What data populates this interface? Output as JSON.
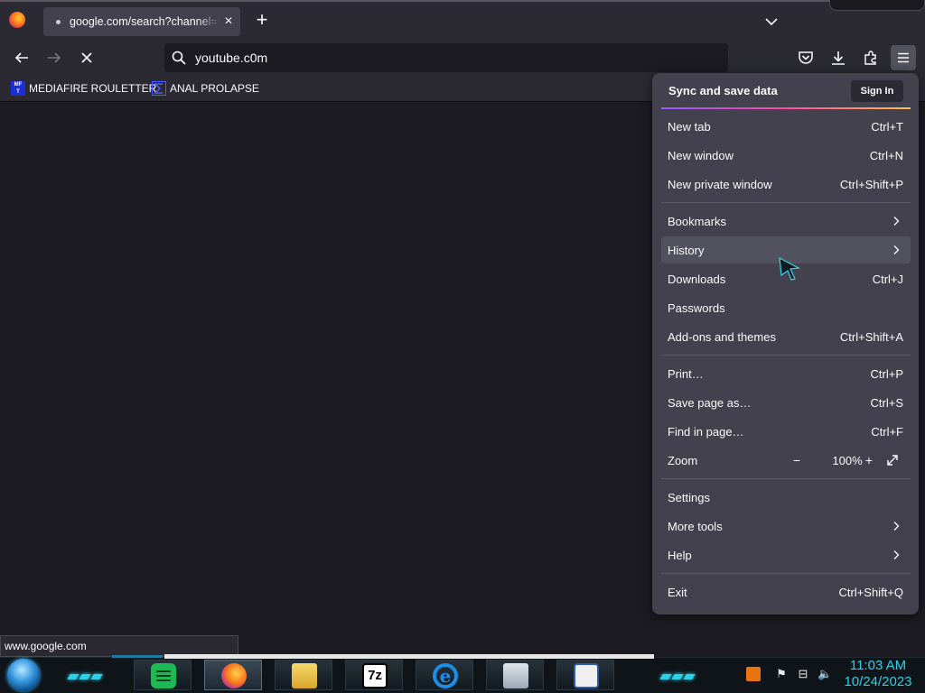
{
  "colors": {
    "chrome_bg": "#2b2a33",
    "page_bg": "#1c1b22",
    "menu_bg": "#42414d",
    "accent_gradient": [
      "#9059ff",
      "#ff4aa2",
      "#ffbd4f"
    ],
    "taskbar_accent": "#2ad1e8"
  },
  "tabstrip": {
    "active_tab": {
      "title": "google.com/search?channel=fs",
      "favicon": "loading-dot-icon",
      "close_icon": "close-icon"
    },
    "new_tab_icon": "plus-icon",
    "list_all_tabs_icon": "chevron-down-icon"
  },
  "navbar": {
    "back_icon": "back-arrow-icon",
    "forward_icon": "forward-arrow-icon",
    "stop_icon": "stop-icon",
    "url": "youtube.c0m",
    "toolbar_icons": [
      "pocket-icon",
      "download-icon",
      "extensions-icon",
      "hamburger-menu-icon"
    ]
  },
  "bookmarks": [
    {
      "label": "MEDIAFIRE ROULETTER",
      "icon": "mft-icon",
      "icon_text": "MF T"
    },
    {
      "label": "ANAL PROLAPSE",
      "icon": "sigma-icon"
    }
  ],
  "status_url": "www.google.com",
  "app_menu": {
    "header": {
      "title": "Sync and save data",
      "sign_in": "Sign In"
    },
    "items": [
      {
        "label": "New tab",
        "shortcut": "Ctrl+T"
      },
      {
        "label": "New window",
        "shortcut": "Ctrl+N"
      },
      {
        "label": "New private window",
        "shortcut": "Ctrl+Shift+P"
      },
      {
        "label": "Bookmarks",
        "shortcut": "",
        "submenu": true
      },
      {
        "label": "History",
        "shortcut": "",
        "submenu": true,
        "hovered": true
      },
      {
        "label": "Downloads",
        "shortcut": "Ctrl+J"
      },
      {
        "label": "Passwords",
        "shortcut": ""
      },
      {
        "label": "Add-ons and themes",
        "shortcut": "Ctrl+Shift+A"
      },
      {
        "label": "Print…",
        "shortcut": "Ctrl+P"
      },
      {
        "label": "Save page as…",
        "shortcut": "Ctrl+S"
      },
      {
        "label": "Find in page…",
        "shortcut": "Ctrl+F"
      },
      {
        "label": "Zoom",
        "zoom_out": "−",
        "zoom_value": "100%",
        "zoom_in": "+",
        "fullscreen_icon": "fullscreen-icon"
      },
      {
        "label": "Settings",
        "shortcut": ""
      },
      {
        "label": "More tools",
        "shortcut": "",
        "submenu": true
      },
      {
        "label": "Help",
        "shortcut": "",
        "submenu": true
      },
      {
        "label": "Exit",
        "shortcut": "Ctrl+Shift+Q"
      }
    ]
  },
  "taskbar": {
    "apps": [
      "spotify-icon",
      "firefox-icon",
      "file-explorer-icon",
      "7zip-icon",
      "internet-explorer-icon",
      "task-manager-icon",
      "window-icon"
    ],
    "sevenzip_label": "7z",
    "ie_label": "e",
    "tray_icons": [
      "java-icon",
      "action-center-icon",
      "network-icon",
      "volume-icon"
    ],
    "time": "11:03 AM",
    "date": "10/24/2023"
  }
}
